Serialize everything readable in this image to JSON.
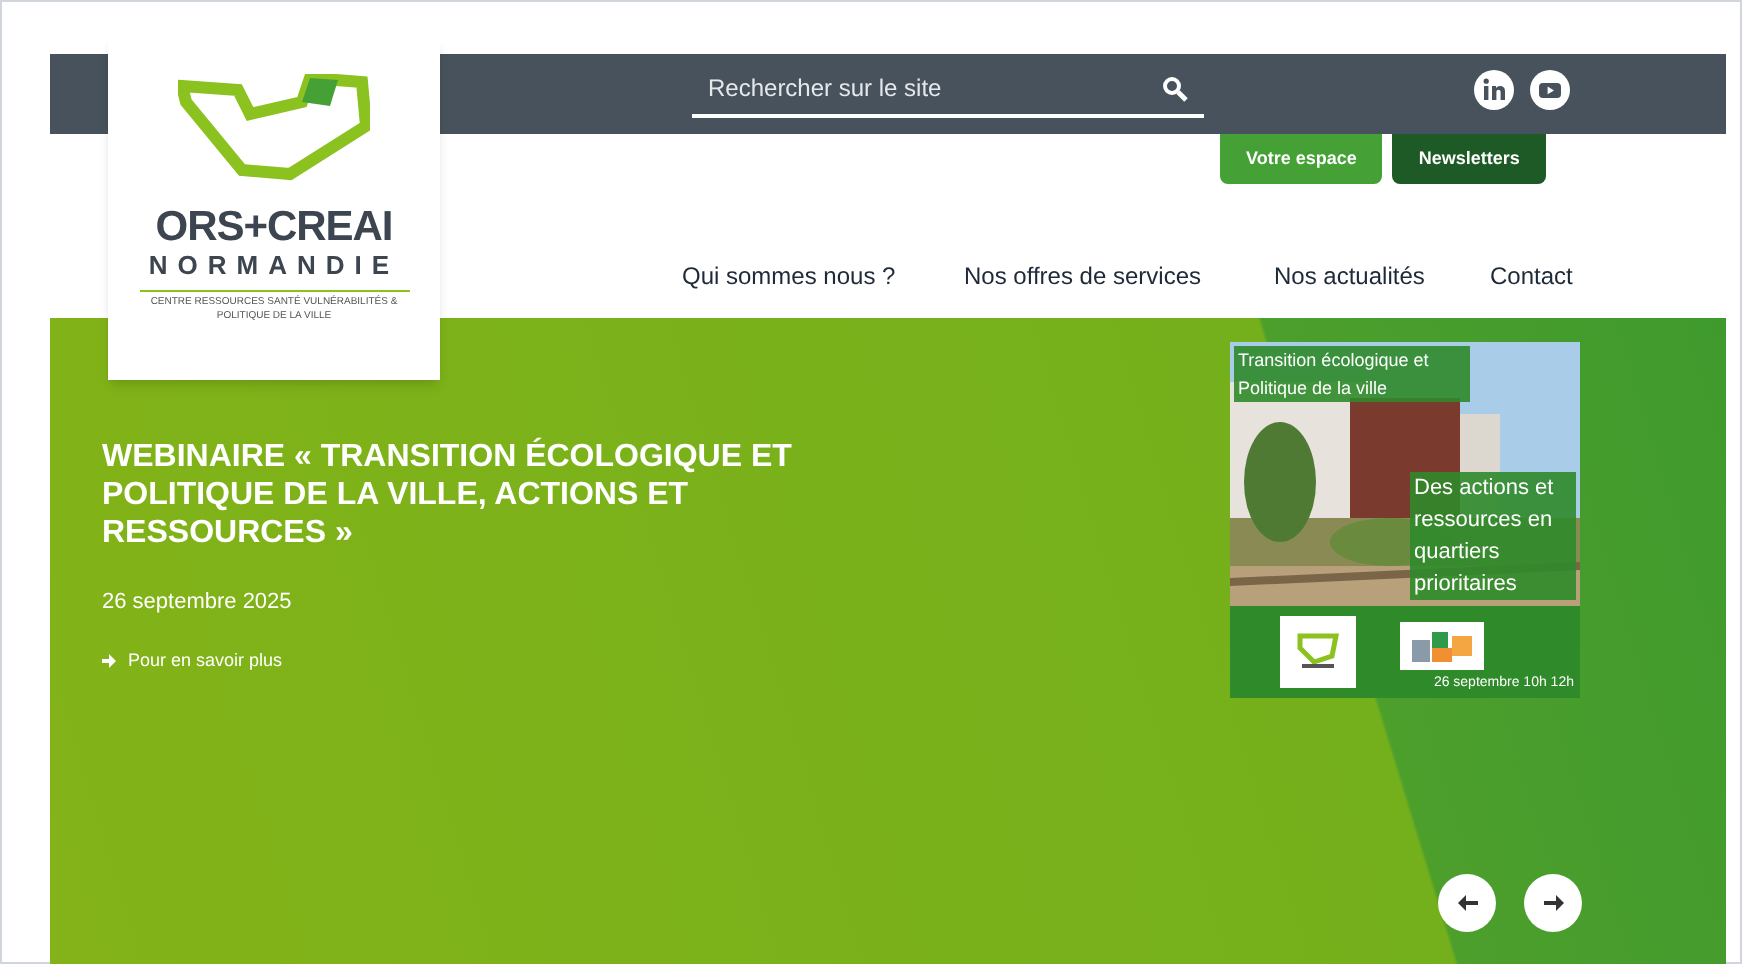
{
  "logo": {
    "line_1": "ORS+CREAI",
    "line_2": "NORMANDIE",
    "tagline": "CENTRE RESSOURCES SANTÉ VULNÉRABILITÉS & POLITIQUE DE LA VILLE"
  },
  "search": {
    "placeholder": "Rechercher sur le site"
  },
  "buttons": [
    {
      "label": "Votre espace",
      "kind": "light"
    },
    {
      "label": "Newsletters",
      "kind": "dark"
    }
  ],
  "nav": [
    {
      "label": "Qui sommes nous ?"
    },
    {
      "label": "Nos offres de services"
    },
    {
      "label": "Nos actualités"
    },
    {
      "label": "Contact"
    }
  ],
  "hero": {
    "title": "WEBINAIRE « TRANSITION ÉCOLOGIQUE ET POLITIQUE DE LA VILLE, ACTIONS ET RESSOURCES »",
    "date": "26 septembre 2025",
    "link": "Pour en savoir plus"
  },
  "poster": {
    "heading": "Transition écologique et Politique de la ville",
    "caption": "Des actions et ressources en quartiers prioritaires",
    "date": "26 septembre  10h 12h"
  }
}
